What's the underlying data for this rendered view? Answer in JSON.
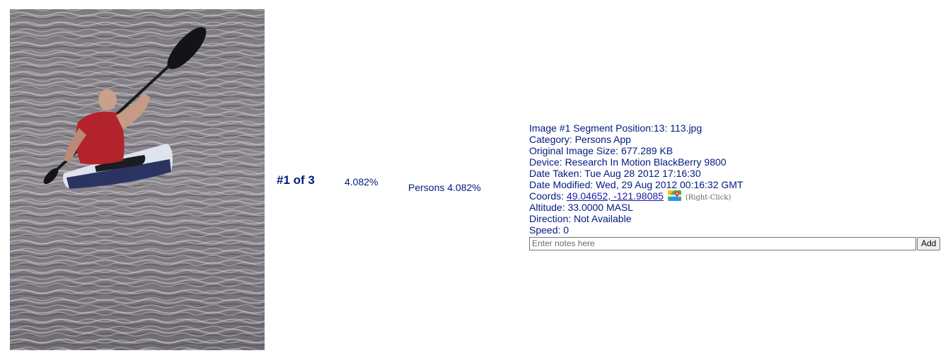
{
  "result": {
    "rank_label": "#1 of 3",
    "score": "4.082%",
    "category_score": "Persons 4.082%"
  },
  "info": {
    "image_line": "Image #1 Segment Position:13: 113.jpg",
    "category_line": "Category: Persons App",
    "size_line": "Original Image Size: 677.289 KB",
    "device_line": "Device: Research In Motion BlackBerry 9800",
    "date_taken_line": "Date Taken: Tue Aug 28 2012 17:16:30",
    "date_modified_line": "Date Modified: Wed, 29 Aug 2012 00:16:32 GMT",
    "coords_label": "Coords:",
    "coords_value": "49.04652, -121.98085",
    "right_click_hint": "(Right-Click)",
    "altitude_line": "Altitude: 33.0000 MASL",
    "direction_line": "Direction: Not Available",
    "speed_line": "Speed: 0"
  },
  "notes": {
    "placeholder": "Enter notes here",
    "add_label": "Add"
  },
  "icons": {
    "maps": "google-maps-icon"
  },
  "colors": {
    "text": "#001a80",
    "link": "#1a1aa6"
  }
}
